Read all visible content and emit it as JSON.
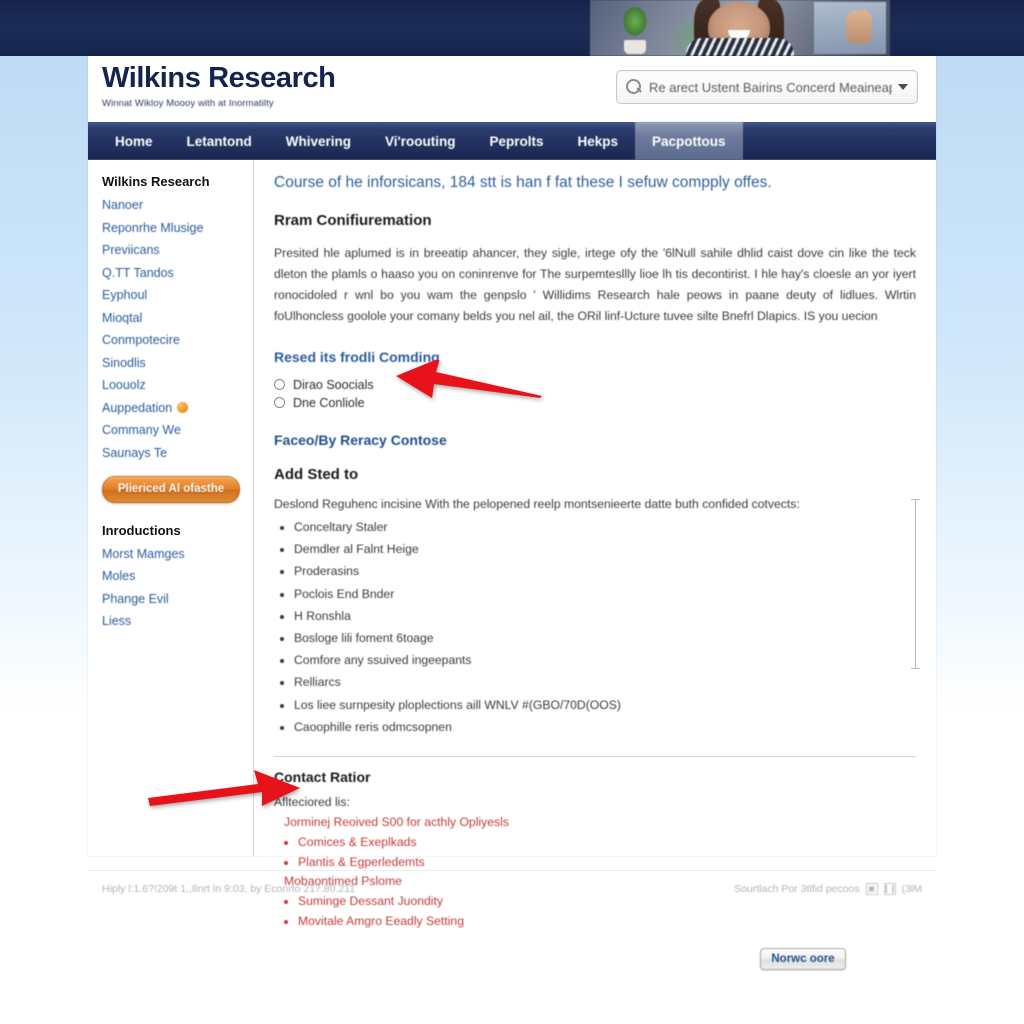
{
  "banner": {
    "alt": "office-photo-woman-smiling"
  },
  "header": {
    "logo_title": "Wilkins Research",
    "logo_tagline": "Winnat Wikloy Moooy with at Inormatilty",
    "search": {
      "icon": "search-icon",
      "value": "Re arect Ustent Bairins Concerd Meaineapy",
      "chevron": "chevron-down-icon"
    }
  },
  "nav": {
    "items": [
      {
        "label": "Home",
        "active": false
      },
      {
        "label": "Letantond",
        "active": false
      },
      {
        "label": "Whivering",
        "active": false
      },
      {
        "label": "Vi'roouting",
        "active": false
      },
      {
        "label": "Peprolts",
        "active": false
      },
      {
        "label": "Hekps",
        "active": false
      },
      {
        "label": "Pacpottous",
        "active": true
      }
    ]
  },
  "sidebar": {
    "heading": "Wilkins Research",
    "items": [
      {
        "label": "Nanoer",
        "badge": false
      },
      {
        "label": "Reponrhe Mlusige",
        "badge": false
      },
      {
        "label": "Previicans",
        "badge": false
      },
      {
        "label": "Q.TT Tandos",
        "badge": false
      },
      {
        "label": "Eyphoul",
        "badge": false
      },
      {
        "label": "Mioqtal",
        "badge": false
      },
      {
        "label": "Conmpotecire",
        "badge": false
      },
      {
        "label": "Sinodlis",
        "badge": false
      },
      {
        "label": "Loouolz",
        "badge": false
      },
      {
        "label": "Auppedation",
        "badge": true
      },
      {
        "label": "Commany We",
        "badge": false
      },
      {
        "label": "Saunays Te",
        "badge": false
      }
    ],
    "button_label": "Pliericed Al ofasthe",
    "heading2": "Inroductions",
    "items2": [
      {
        "label": "Morst Mamges"
      },
      {
        "label": "Moles"
      },
      {
        "label": "Phange Evil"
      },
      {
        "label": "Liess"
      }
    ]
  },
  "main": {
    "page_title": "Course of he inforsicans, 184 stt is han f fat these I sefuw compply offes.",
    "section1_heading": "Rram Conifiuremation",
    "paragraph": "Presited hle aplumed is in breeatip ahancer, they sigle, irtege ofy the '6lNull sahile dhlid caist dove cin like the teck dleton the plamls o haaso you on coninrenve for The surpemtesllly lioe lh tis decontirist. I hle hay's cloesle an yor iyert ronocidoled r wnl bo you wam the genpslo ' Willidims Research hale peows in paane deuty of lidlues. Wlrtin foUlhoncless goolole your comany belds you nel ail, the ORil linf-Ucture tuvee silte Bnefrl Dlapics. IS you uecion",
    "section2_heading": "Resed its frodli Comding",
    "radios": [
      {
        "label": "Dirao Soocials",
        "selected": false
      },
      {
        "label": "Dne Conliole",
        "selected": false
      }
    ],
    "link_heading": "Faceo/By Reracy Contose",
    "section3_heading": "Add Sted to",
    "list_intro": "Deslond Reguhenc incisine With the pelopened reelp montsenieerte datte buth confided cotvects:",
    "bullets": [
      "Conceltary Staler",
      "Demdler al Falnt Heige",
      "Proderasins",
      "Poclois End Bnder",
      "H Ronshla",
      "Bosloge lili foment 6toage",
      "Comfore any ssuived ingeepants",
      "Relliarcs",
      "Los liee surnpesity ploplections aill WNLV #(GBO/70D(OOS)",
      "Caoophille reris odmcsopnen"
    ],
    "contact_heading": "Contact Ratior",
    "contact_intro": "Aflteciored lis:",
    "red_lines": [
      {
        "text": "Jorminej Reoived S00 for acthly Opliyesls",
        "bullet": false
      },
      {
        "text": "Comices & Exeplkads",
        "bullet": true
      },
      {
        "text": "Plantis & Egperledemts",
        "bullet": true
      },
      {
        "text": "Mobaontimed Pslome",
        "bullet": false
      },
      {
        "text": "Suminge Dessant Juondity",
        "bullet": true
      },
      {
        "text": "Movitale Amgro Eeadly Setting",
        "bullet": true
      }
    ],
    "submit_button": "Norwc oore"
  },
  "footer": {
    "left": "Hiply l:1.6?!209t  1,,8nrt ln 9:03, by Econrto 217.80.211",
    "right": "Sourtlach Por 3tlfid pecoos",
    "icons": [
      "grid-icon",
      "pause-icon"
    ],
    "icon_text": "(3lM"
  },
  "annotations": {
    "arrow1": "red-arrow-pointing-at-radio-options",
    "arrow2": "red-arrow-pointing-at-red-contact-links"
  },
  "colors": {
    "nav_navy": "#21305d",
    "link_blue": "#2a5c9a",
    "accent_orange": "#e4802a",
    "alert_red": "#c33a3a",
    "annotation_red": "#e8131a"
  }
}
